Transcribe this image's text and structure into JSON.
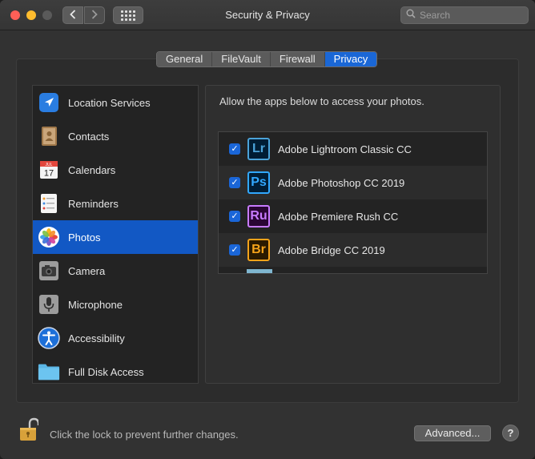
{
  "window": {
    "title": "Security & Privacy"
  },
  "toolbar": {
    "back_icon": "chevron-left-icon",
    "forward_icon": "chevron-right-icon",
    "grid_icon": "grid-icon",
    "search_placeholder": "Search"
  },
  "tabs": [
    {
      "label": "General",
      "active": false
    },
    {
      "label": "FileVault",
      "active": false
    },
    {
      "label": "Firewall",
      "active": false
    },
    {
      "label": "Privacy",
      "active": true
    }
  ],
  "sidebar": {
    "items": [
      {
        "label": "Location Services",
        "icon": "location-arrow-icon"
      },
      {
        "label": "Contacts",
        "icon": "contacts-book-icon"
      },
      {
        "label": "Calendars",
        "icon": "calendar-icon",
        "calendar_month": "JUL",
        "calendar_day": "17"
      },
      {
        "label": "Reminders",
        "icon": "reminders-list-icon"
      },
      {
        "label": "Photos",
        "icon": "photos-flower-icon",
        "selected": true
      },
      {
        "label": "Camera",
        "icon": "camera-icon"
      },
      {
        "label": "Microphone",
        "icon": "microphone-icon"
      },
      {
        "label": "Accessibility",
        "icon": "accessibility-icon"
      },
      {
        "label": "Full Disk Access",
        "icon": "folder-icon"
      }
    ]
  },
  "content": {
    "description": "Allow the apps below to access your photos.",
    "apps": [
      {
        "name": "Adobe Lightroom Classic CC",
        "abbr": "Lr",
        "checked": true,
        "color": "#4ba3d9",
        "bg": "#001d34"
      },
      {
        "name": "Adobe Photoshop CC 2019",
        "abbr": "Ps",
        "checked": true,
        "color": "#31a8ff",
        "bg": "#001e36"
      },
      {
        "name": "Adobe Premiere Rush CC",
        "abbr": "Ru",
        "checked": true,
        "color": "#c87bff",
        "bg": "#2a0634"
      },
      {
        "name": "Adobe Bridge CC 2019",
        "abbr": "Br",
        "checked": true,
        "color": "#f5a31a",
        "bg": "#2a1a00"
      }
    ]
  },
  "footer": {
    "lock_text": "Click the lock to prevent further changes.",
    "advanced_label": "Advanced...",
    "help_label": "?"
  }
}
